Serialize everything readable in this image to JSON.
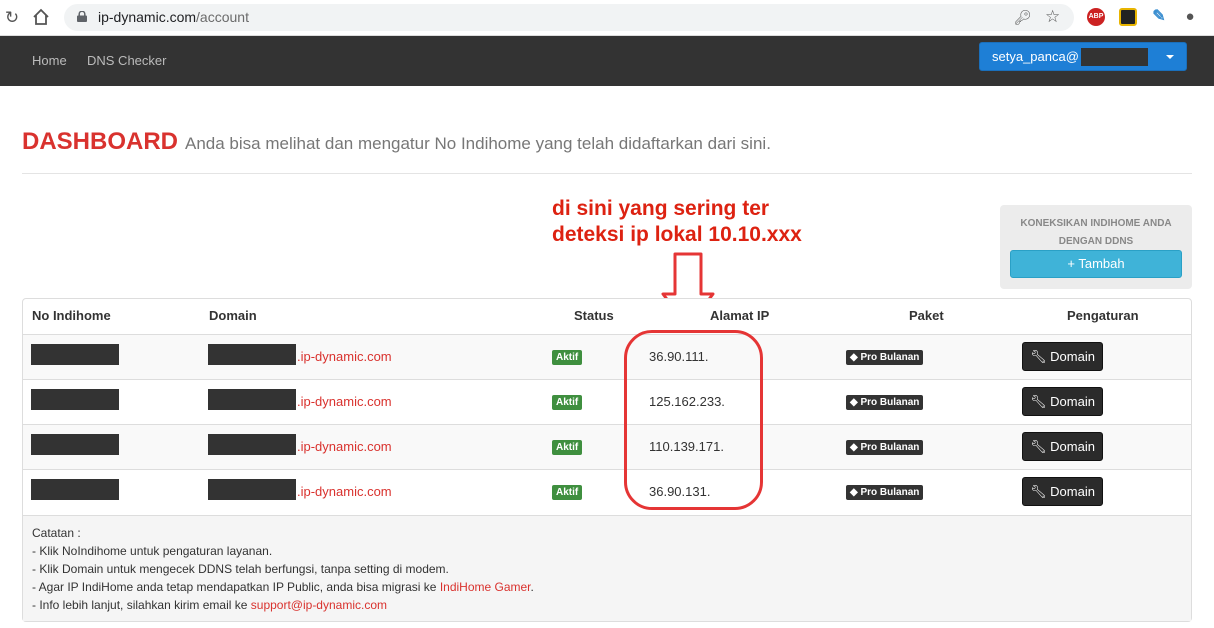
{
  "browser": {
    "url_host": "ip-dynamic.com",
    "url_path": "/account",
    "extensions": [
      {
        "name": "adblock-plus-icon",
        "label": "ABP",
        "color": "#c22"
      },
      {
        "name": "extension-icon",
        "label": "",
        "color": "#333"
      },
      {
        "name": "pen-icon",
        "label": "",
        "color": "#3a8ed0"
      },
      {
        "name": "people-icon",
        "label": "",
        "color": "#555"
      }
    ]
  },
  "navbar": {
    "home": "Home",
    "dns_checker": "DNS Checker",
    "user": "setya_panca@"
  },
  "header": {
    "title": "DASHBOARD",
    "subtitle": "Anda bisa melihat dan mengatur No Indihome yang telah didaftarkan dari sini."
  },
  "annotation": {
    "line1": "di sini yang sering ter",
    "line2": "deteksi ip lokal 10.10.xxx"
  },
  "addbox": {
    "label1": "KONEKSIKAN INDIHOME ANDA",
    "label2": "DENGAN DDNS",
    "button": "+ Tambah"
  },
  "table": {
    "headers": [
      "No Indihome",
      "Domain",
      "Status",
      "Alamat IP",
      "Paket",
      "Pengaturan"
    ],
    "rows": [
      {
        "domain": ".ip-dynamic.com",
        "status": "Aktif",
        "ip": "36.90.111.",
        "paket": "Pro Bulanan",
        "action": "Domain"
      },
      {
        "domain": ".ip-dynamic.com",
        "status": "Aktif",
        "ip": "125.162.233.",
        "paket": "Pro Bulanan",
        "action": "Domain"
      },
      {
        "domain": ".ip-dynamic.com",
        "status": "Aktif",
        "ip": "110.139.171.",
        "paket": "Pro Bulanan",
        "action": "Domain"
      },
      {
        "domain": ".ip-dynamic.com",
        "status": "Aktif",
        "ip": "36.90.131.",
        "paket": "Pro Bulanan",
        "action": "Domain"
      }
    ]
  },
  "notes": {
    "title": "Catatan :",
    "line1": "- Klik NoIndihome untuk pengaturan layanan.",
    "line2": "- Klik Domain untuk mengecek DDNS telah berfungsi, tanpa setting di modem.",
    "line3_pre": "- Agar IP IndiHome anda tetap mendapatkan IP Public, anda bisa migrasi ke ",
    "line3_link": "IndiHome Gamer",
    "line3_post": ".",
    "line4_pre": "- Info lebih lanjut, silahkan kirim email ke ",
    "line4_link": "support@ip-dynamic.com"
  }
}
